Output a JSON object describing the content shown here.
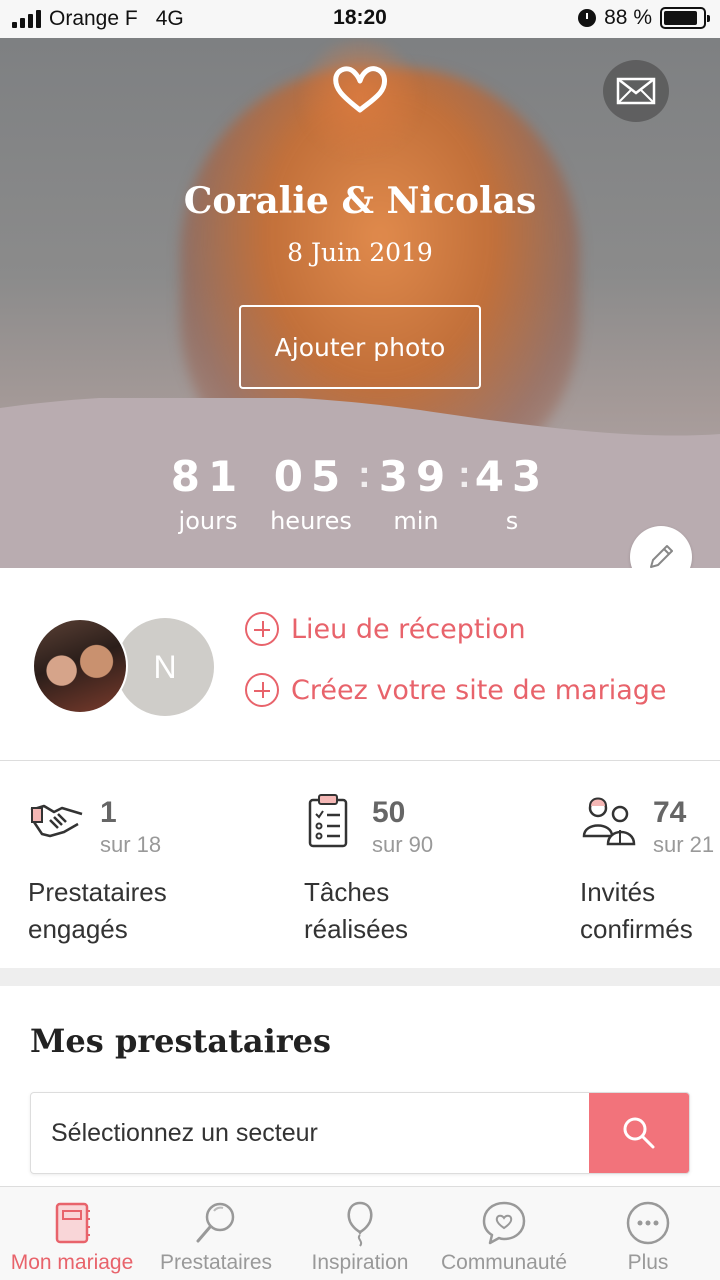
{
  "status_bar": {
    "carrier": "Orange F",
    "network": "4G",
    "time": "18:20",
    "battery": "88 %",
    "battery_level": 0.88
  },
  "hero": {
    "names": "Coralie & Nicolas",
    "date": "8 Juin 2019",
    "add_photo_label": "Ajouter photo",
    "icons": {
      "logo": "heart-icon",
      "mail": "mail-icon",
      "edit": "pencil-icon"
    }
  },
  "countdown": {
    "days": "81",
    "days_label": "jours",
    "hours": "05",
    "hours_label": "heures",
    "minutes": "39",
    "minutes_label": "min",
    "seconds": "43",
    "seconds_label": "s",
    "separator": ":"
  },
  "couple": {
    "partner_initial": "N",
    "links": [
      {
        "label": "Lieu de réception"
      },
      {
        "label": "Créez votre site de mariage"
      }
    ]
  },
  "stats": [
    {
      "icon": "handshake-icon",
      "count": "1",
      "total": "sur 18",
      "label_line1": "Prestataires",
      "label_line2": "engagés"
    },
    {
      "icon": "checklist-icon",
      "count": "50",
      "total": "sur 90",
      "label_line1": "Tâches",
      "label_line2": "réalisées"
    },
    {
      "icon": "guests-icon",
      "count": "74",
      "total": "sur 21",
      "label_line1": "Invités",
      "label_line2": "confirmés"
    }
  ],
  "providers": {
    "title": "Mes prestataires",
    "select_placeholder": "Sélectionnez un secteur"
  },
  "tabs": [
    {
      "label": "Mon mariage",
      "icon": "planner-book-icon",
      "active": true
    },
    {
      "label": "Prestataires",
      "icon": "magnifier-icon",
      "active": false
    },
    {
      "label": "Inspiration",
      "icon": "balloon-icon",
      "active": false
    },
    {
      "label": "Communauté",
      "icon": "chat-heart-icon",
      "active": false
    },
    {
      "label": "Plus",
      "icon": "more-dots-icon",
      "active": false
    }
  ],
  "colors": {
    "accent": "#e8636b",
    "search_button": "#f2737b",
    "countdown_band": "#b9acb0"
  }
}
